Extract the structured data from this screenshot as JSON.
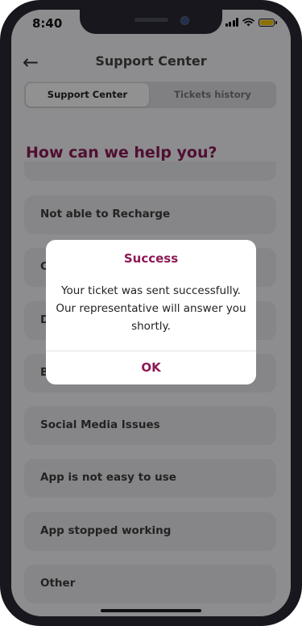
{
  "status_bar": {
    "time": "8:40"
  },
  "header": {
    "title": "Support Center"
  },
  "tabs": [
    {
      "label": "Support Center",
      "active": true
    },
    {
      "label": "Tickets history",
      "active": false
    }
  ],
  "main": {
    "heading": "How can we help you?",
    "options": [
      "Not able to Recharge",
      "Social Media Issues",
      "App is not easy to use",
      "App stopped working",
      "Other"
    ],
    "partially_hidden_option_initials": [
      "C",
      "D",
      "B"
    ]
  },
  "dialog": {
    "title": "Success",
    "message": "Your ticket was sent successfully. Our representative will answer you shortly.",
    "ok_label": "OK"
  },
  "colors": {
    "accent": "#8b1a55",
    "battery": "#f2c200"
  },
  "icons": {
    "back": "arrow-left-icon"
  }
}
